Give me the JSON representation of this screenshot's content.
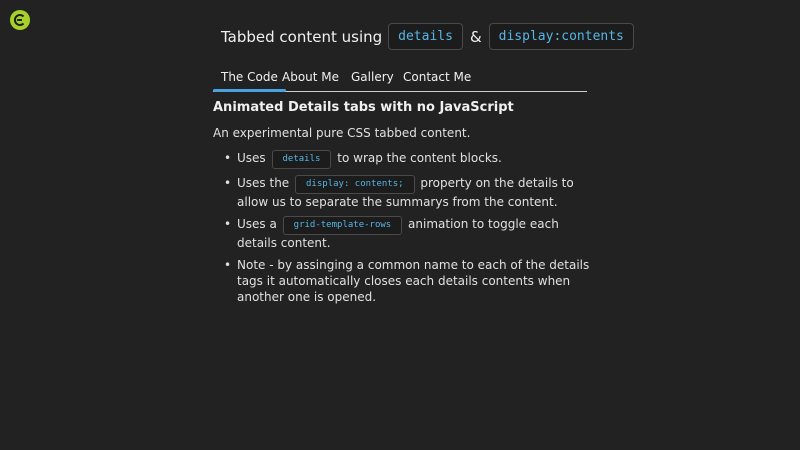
{
  "logo": {
    "icon": "codepen-c-logo-icon",
    "color": "#a7d129"
  },
  "header": {
    "title_text": "Tabbed content using",
    "code_1": "details",
    "ampersand": "&",
    "code_2": "display:contents"
  },
  "tabs": [
    {
      "label": "The Code",
      "active": true
    },
    {
      "label": "About Me",
      "active": false
    },
    {
      "label": "Gallery",
      "active": false
    },
    {
      "label": "Contact Me",
      "active": false
    }
  ],
  "content": {
    "heading": "Animated Details tabs with no JavaScript",
    "intro": "An experimental pure CSS tabbed content.",
    "items": [
      {
        "pre": "Uses",
        "code": "details",
        "post": "to wrap the content blocks."
      },
      {
        "pre": "Uses the",
        "code": "display: contents;",
        "post": "property on the details to allow us to separate the summarys from the content."
      },
      {
        "pre": "Uses a",
        "code": "grid-template-rows",
        "post": "animation to toggle each details content."
      },
      {
        "pre": "Note - by assinging a common name to each of the details tags it automatically closes each details contents when another one is opened."
      }
    ]
  },
  "colors": {
    "accent": "#4aa3df",
    "code_text": "#56b6e6",
    "background": "#222222"
  }
}
